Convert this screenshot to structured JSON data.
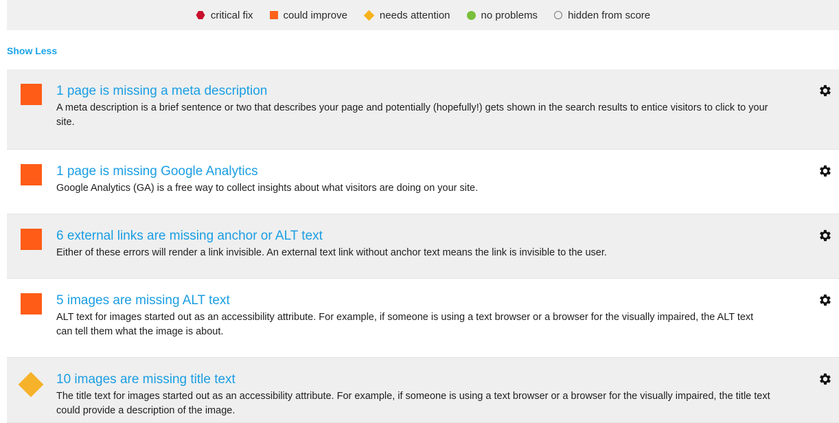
{
  "legend": {
    "items": [
      {
        "label": "critical fix",
        "icon": "hexagon-icon",
        "color": "#c8102e"
      },
      {
        "label": "could improve",
        "icon": "square-icon",
        "color": "#ff6119"
      },
      {
        "label": "needs attention",
        "icon": "diamond-icon",
        "color": "#f5b21d"
      },
      {
        "label": "no problems",
        "icon": "circle-icon",
        "color": "#79bf3b"
      },
      {
        "label": "hidden from score",
        "icon": "circle-outline-icon",
        "color": "#777777"
      }
    ]
  },
  "show_less_label": "Show Less",
  "issues": [
    {
      "severity": "could improve",
      "title": "1 page is missing a meta description",
      "description": "A meta description is a brief sentence or two that describes your page and potentially (hopefully!) gets shown in the search results to entice visitors to click to your site."
    },
    {
      "severity": "could improve",
      "title": "1 page is missing Google Analytics",
      "description": "Google Analytics (GA) is a free way to collect insights about what visitors are doing on your site."
    },
    {
      "severity": "could improve",
      "title": "6 external links are missing anchor or ALT text",
      "description": "Either of these errors will render a link invisible. An external text link without anchor text means the link is invisible to the user."
    },
    {
      "severity": "could improve",
      "title": "5 images are missing ALT text",
      "description": "ALT text for images started out as an accessibility attribute. For example, if someone is using a text browser or a browser for the visually impaired, the ALT text can tell them what the image is about."
    },
    {
      "severity": "needs attention",
      "title": "10 images are missing title text",
      "description": "The title text for images started out as an accessibility attribute. For example, if someone is using a text browser or a browser for the visually impaired, the title text could provide a description of the image."
    }
  ]
}
